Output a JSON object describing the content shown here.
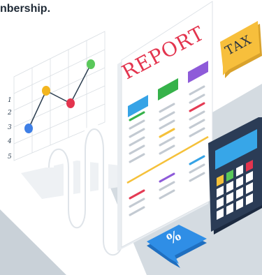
{
  "header": {
    "text": "nbership."
  },
  "report": {
    "title": "REPORT",
    "colors": {
      "bar_green": "#36b24a",
      "bar_purple": "#8e5bd9",
      "bar_blue": "#36a3e6",
      "accent_red": "#e43b54",
      "accent_yellow": "#f5c13a"
    }
  },
  "tax_tag": {
    "text": "TAX",
    "color": "#f7bf3c"
  },
  "percent_tag": {
    "text": "%",
    "color": "#2f8ee6"
  },
  "chart": {
    "tick_labels": [
      "1",
      "2",
      "3",
      "4",
      "5"
    ],
    "point_colors": [
      "#3e7fe6",
      "#f3b51e",
      "#e3344e",
      "#5ac85a"
    ]
  },
  "calculator": {
    "body_color": "#2b3c56",
    "screen_color": "#37a6e8"
  }
}
